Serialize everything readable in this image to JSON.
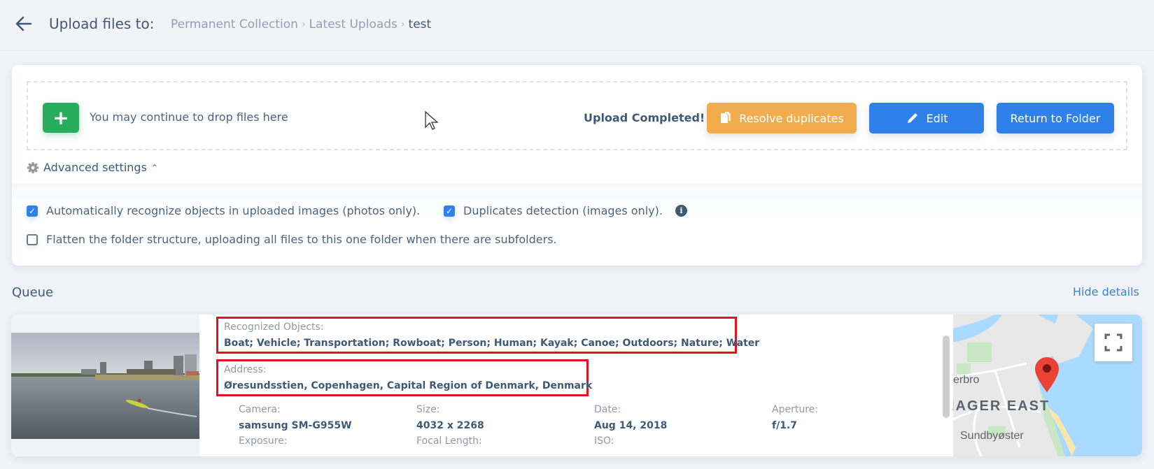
{
  "header": {
    "title": "Upload files to:",
    "breadcrumb": [
      "Permanent Collection",
      "Latest Uploads",
      "test"
    ]
  },
  "upload": {
    "drop_text": "You may continue to drop files here",
    "status": "Upload Completed!",
    "buttons": {
      "resolve": "Resolve duplicates",
      "edit": "Edit",
      "return": "Return to Folder"
    },
    "advanced_label": "Advanced settings"
  },
  "settings": {
    "options": [
      {
        "label": "Automatically recognize objects in uploaded images (photos only).",
        "checked": true
      },
      {
        "label": "Duplicates detection (images only).",
        "checked": true
      },
      {
        "label": "Flatten the folder structure, uploading all files to this one folder when there are subfolders.",
        "checked": false
      }
    ]
  },
  "queue": {
    "title": "Queue",
    "hide_details": "Hide details",
    "item": {
      "recognized_label": "Recognized Objects:",
      "recognized_value": "Boat; Vehicle; Transportation; Rowboat; Person; Human; Kayak; Canoe; Outdoors; Nature; Water",
      "address_label": "Address:",
      "address_value": "Øresundsstien, Copenhagen, Capital Region of Denmark, Denmark",
      "meta": [
        {
          "label": "Camera:",
          "value": "samsung SM-G955W"
        },
        {
          "label": "Size:",
          "value": "4032 x 2268"
        },
        {
          "label": "Date:",
          "value": "Aug 14, 2018"
        },
        {
          "label": "Aperture:",
          "value": "f/1.7"
        },
        {
          "label": "Exposure:",
          "value": ""
        },
        {
          "label": "Focal Length:",
          "value": ""
        },
        {
          "label": "ISO:",
          "value": ""
        }
      ],
      "map_labels": [
        "erbro",
        "IAGER EAST",
        "Sundbyøster"
      ]
    }
  },
  "colors": {
    "green": "#28ad5d",
    "orange": "#f0ac4d",
    "blue": "#2f80e8",
    "highlight": "#e0141e"
  }
}
